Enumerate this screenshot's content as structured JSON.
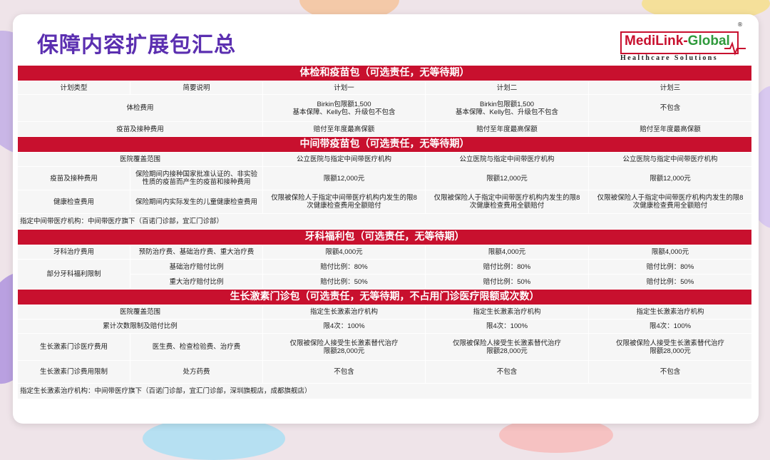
{
  "page": {
    "title": "保障内容扩展包汇总",
    "logo": {
      "brand_red": "MediLink-",
      "brand_green": "Global",
      "tagline": "Healthcare Solutions",
      "reg_mark": "®"
    }
  },
  "colors": {
    "band": "#c8102e",
    "title": "#5b2fb0",
    "logo_green": "#2f9a3c"
  },
  "s1": {
    "header": "体检和疫苗包（可选责任，无等待期）",
    "col_plan_type": "计划类型",
    "col_desc": "简要说明",
    "plans": [
      "计划一",
      "计划二",
      "计划三"
    ],
    "r1": {
      "label": "体检费用",
      "v1": "Birkin包限额1,500\n基本保障、Kelly包、升级包不包含",
      "v2": "Birkin包限额1,500\n基本保障、Kelly包、升级包不包含",
      "v3": "不包含"
    },
    "r2": {
      "label": "疫苗及接种费用",
      "v1": "赔付至年度最高保额",
      "v2": "赔付至年度最高保额",
      "v3": "赔付至年度最高保额"
    }
  },
  "s2": {
    "header": "中间带疫苗包（可选责任，无等待期）",
    "r0": {
      "label": "医院覆盖范围",
      "v1": "公立医院与指定中间带医疗机构",
      "v2": "公立医院与指定中间带医疗机构",
      "v3": "公立医院与指定中间带医疗机构"
    },
    "r1": {
      "label": "疫苗及接种费用",
      "desc": "保险期间内接种国家批准认证的、非实验\n性质的疫苗而产生的疫苗和接种费用",
      "v1": "限额12,000元",
      "v2": "限额12,000元",
      "v3": "限额12,000元"
    },
    "r2": {
      "label": "健康检查费用",
      "desc": "保险期间内实际发生的儿童健康检查费用",
      "v1": "仅限被保险人于指定中间带医疗机构内发生的限8\n次健康检查费用全额赔付",
      "v2": "仅限被保险人于指定中间带医疗机构内发生的限8\n次健康检查费用全额赔付",
      "v3": "仅限被保险人于指定中间带医疗机构内发生的限8\n次健康检查费用全额赔付"
    },
    "note": "指定中间带医疗机构：中间带医疗旗下（百诺门诊部，宜汇门诊部）"
  },
  "s3": {
    "header": "牙科福利包（可选责任，无等待期）",
    "r1": {
      "label": "牙科治疗费用",
      "desc": "预防治疗费、基础治疗费、重大治疗费",
      "v1": "限额4,000元",
      "v2": "限额4,000元",
      "v3": "限额4,000元"
    },
    "r2": {
      "label": "部分牙科福利限制",
      "desc": "基础治疗赔付比例",
      "v1": "赔付比例：80%",
      "v2": "赔付比例：80%",
      "v3": "赔付比例：80%"
    },
    "r3": {
      "desc": "重大治疗赔付比例",
      "v1": "赔付比例：50%",
      "v2": "赔付比例：50%",
      "v3": "赔付比例：50%"
    }
  },
  "s4": {
    "header": "生长激素门诊包（可选责任，无等待期，不占用门诊医疗限额或次数）",
    "r0": {
      "label": "医院覆盖范围",
      "v1": "指定生长激素治疗机构",
      "v2": "指定生长激素治疗机构",
      "v3": "指定生长激素治疗机构"
    },
    "r1": {
      "label": "累计次数限制及赔付比例",
      "v1": "限4次：100%",
      "v2": "限4次：100%",
      "v3": "限4次：100%"
    },
    "r2": {
      "label": "生长激素门诊医疗费用",
      "desc": "医生费、检查检验费、治疗费",
      "v1": "仅限被保险人接受生长激素替代治疗\n限额28,000元",
      "v2": "仅限被保险人接受生长激素替代治疗\n限额28,000元",
      "v3": "仅限被保险人接受生长激素替代治疗\n限额28,000元"
    },
    "r3": {
      "label": "生长激素门诊费用限制",
      "desc": "处方药费",
      "v1": "不包含",
      "v2": "不包含",
      "v3": "不包含"
    },
    "note": "指定生长激素治疗机构：中间带医疗旗下（百诺门诊部，宜汇门诊部，深圳旗舰店，成都旗舰店）"
  }
}
